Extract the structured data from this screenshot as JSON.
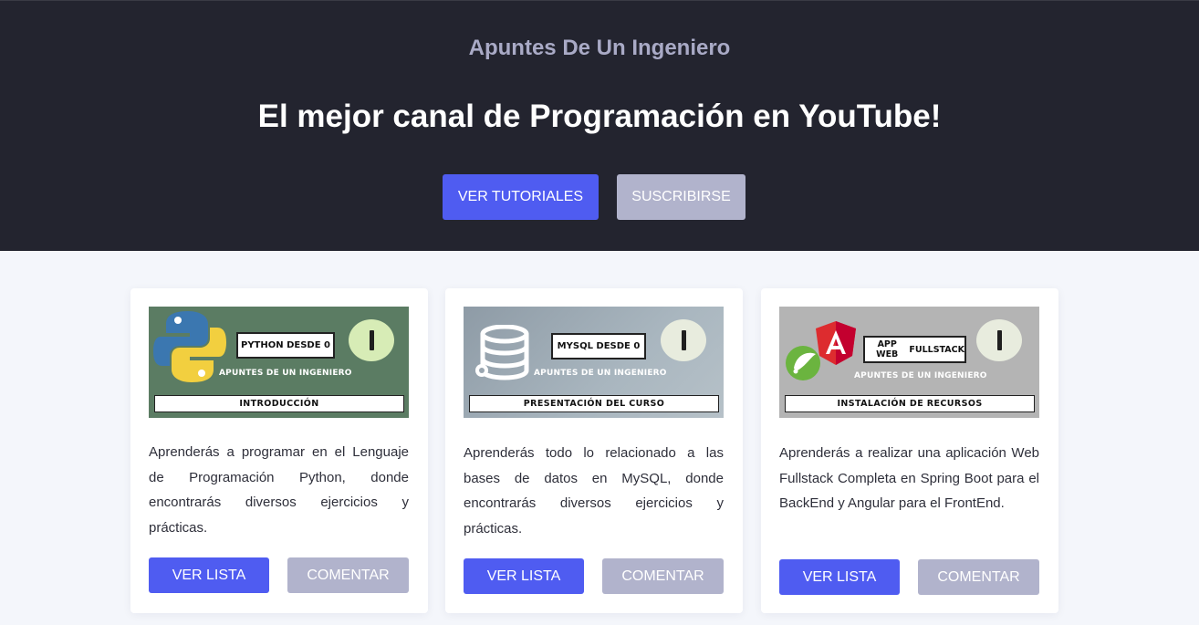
{
  "hero": {
    "brand": "Apuntes De Un Ingeniero",
    "headline": "El mejor canal de Programación en YouTube!",
    "primary_button": "VER TUTORIALES",
    "secondary_button": "SUSCRIBIRSE"
  },
  "cards": [
    {
      "thumb": {
        "title": "PYTHON DESDE 0",
        "brand": "APUNTES DE UN INGENIERO",
        "bar": "INTRODUCCIÓN",
        "icon": "python-logo-icon"
      },
      "description": "Aprenderás a programar en el Lenguaje de Programación Python, donde encontrarás diversos ejercicios y prácticas.",
      "primary_button": "VER LISTA",
      "secondary_button": "COMENTAR"
    },
    {
      "thumb": {
        "title": "MYSQL DESDE 0",
        "brand": "APUNTES DE UN INGENIERO",
        "bar": "PRESENTACIÓN DEL CURSO",
        "icon": "database-icon"
      },
      "description": "Aprenderás todo lo relacionado a las bases de datos en MySQL, donde encontrarás diversos ejercicios y prácticas.",
      "primary_button": "VER LISTA",
      "secondary_button": "COMENTAR"
    },
    {
      "thumb": {
        "title_line1": "APP WEB",
        "title_line2": "FULLSTACK",
        "brand": "APUNTES DE UN INGENIERO",
        "bar": "INSTALACIÓN DE RECURSOS",
        "icon": "angular-spring-icon"
      },
      "description": "Aprenderás a realizar una aplicación Web Fullstack Completa en Spring Boot para el BackEnd y Angular para el FrontEnd.",
      "primary_button": "VER LISTA",
      "secondary_button": "COMENTAR"
    }
  ],
  "colors": {
    "hero_background": "#23242f",
    "primary": "#4f5cf1",
    "secondary": "#b1b3cc",
    "page_background": "#f4f6fb"
  }
}
